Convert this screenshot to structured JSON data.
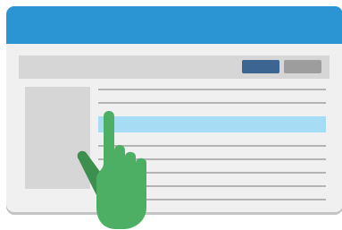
{
  "colors": {
    "titlebar": "#2b95d4",
    "primary_button": "#3d6591",
    "secondary_button": "#9d9d9d",
    "selected_row": "#a6dcf4",
    "hand": "#4daf64",
    "hand_shadow": "#3d8f50"
  },
  "icons": {
    "pointer": "pointing-hand-icon"
  },
  "list": {
    "row_count": 8,
    "selected_index": 2
  }
}
